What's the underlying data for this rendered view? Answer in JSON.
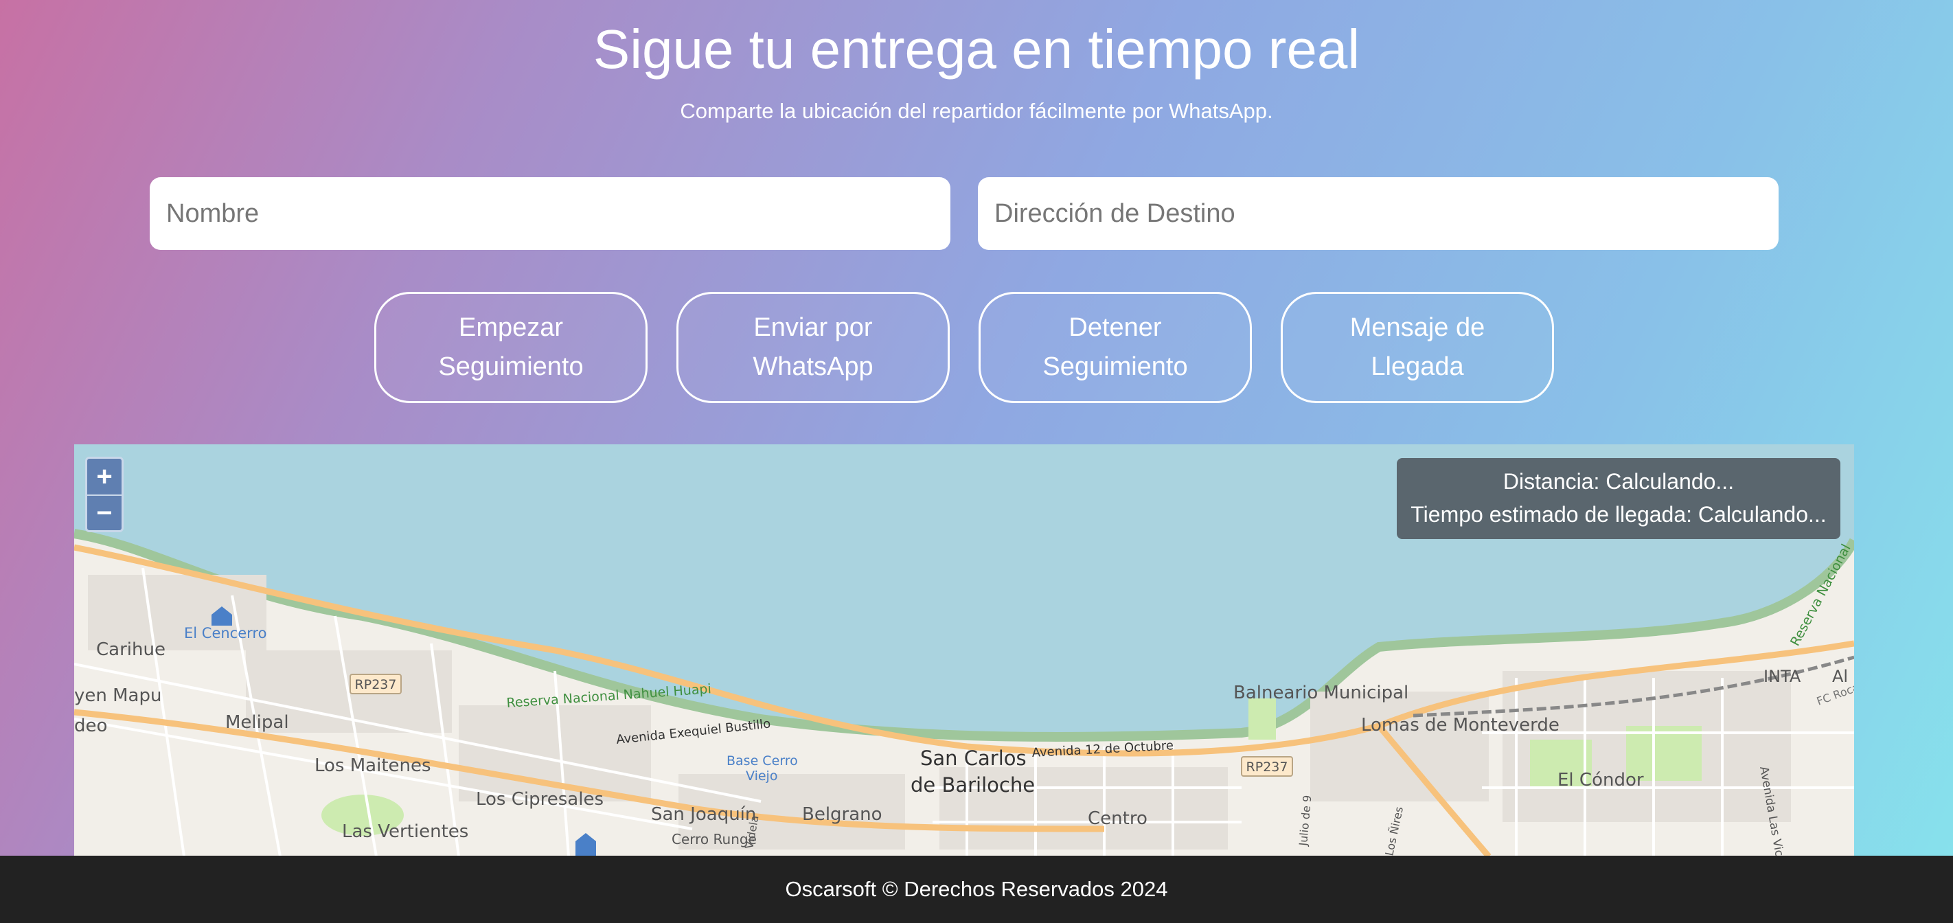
{
  "header": {
    "title": "Sigue tu entrega en tiempo real",
    "subtitle": "Comparte la ubicación del repartidor fácilmente por WhatsApp."
  },
  "form": {
    "name_placeholder": "Nombre",
    "name_value": "",
    "destination_placeholder": "Dirección de Destino",
    "destination_value": ""
  },
  "buttons": {
    "start": "Empezar Seguimiento",
    "whatsapp": "Enviar por WhatsApp",
    "stop": "Detener Seguimiento",
    "arrival": "Mensaje de Llegada"
  },
  "map": {
    "zoom_in": "+",
    "zoom_out": "−",
    "distance": "Distancia: Calculando...",
    "eta": "Tiempo estimado de llegada: Calculando...",
    "labels": {
      "el_cencerro": "El Cencerro",
      "carihue": "Carihue",
      "yen_mapu": "yen Mapu",
      "deo": "deo",
      "melipal": "Melipal",
      "los_maitenes": "Los Maitenes",
      "los_cipresales": "Los Cipresales",
      "las_vertientes": "Las Vertientes",
      "san_joaquin": "San Joaquín",
      "cerro_runge": "Cerro Runge",
      "belgrano": "Belgrano",
      "san_carlos_1": "San Carlos",
      "san_carlos_2": "de Bariloche",
      "centro": "Centro",
      "balneario": "Balneario Municipal",
      "lomas": "Lomas de Monteverde",
      "el_condor": "El Cóndor",
      "inta": "INTA",
      "reserva": "Reserva Nacional Nahuel Huapi",
      "reserva_right": "Reserva Nacional",
      "av_bustillo": "Avenida Exequiel Bustillo",
      "av_12_octubre": "Avenida 12 de Octubre",
      "base_cerro_1": "Base Cerro",
      "base_cerro_2": "Viejo",
      "rp237": "RP237",
      "rp237_b": "RP237",
      "fc_roca": "FC Roca",
      "av_las_victorias": "Avenida Las Vic",
      "vidal": "Videla",
      "julio": "Julio de 9",
      "nires": "Los Ñires",
      "al": "Al"
    }
  },
  "footer": {
    "text": "Oscarsoft © Derechos Reservados 2024"
  }
}
